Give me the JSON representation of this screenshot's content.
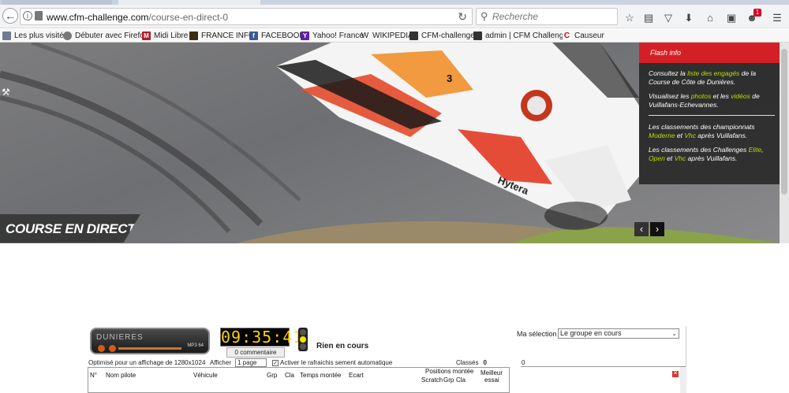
{
  "browser": {
    "url_host": "www.cfm-challenge.com",
    "url_path": "/course-en-direct-0",
    "search_placeholder": "Recherche",
    "notification_count": "1",
    "bookmarks": [
      {
        "label": "Les plus visités",
        "icon": "bookmarks-folder-icon"
      },
      {
        "label": "Débuter avec Firefox",
        "icon": "firefox-icon"
      },
      {
        "label": "Midi Libre",
        "icon": "midilibre-m-icon"
      },
      {
        "label": "FRANCE INFO",
        "icon": "franceinfo-icon"
      },
      {
        "label": "FACEBOOK",
        "icon": "facebook-icon"
      },
      {
        "label": "Yahoo! France",
        "icon": "yahoo-y-icon"
      },
      {
        "label": "WIKIPEDIA",
        "icon": "wikipedia-w-icon"
      },
      {
        "label": "CFM-challenge",
        "icon": "cfm-icon"
      },
      {
        "label": "admin | CFM Challenge",
        "icon": "cfm-admin-icon"
      },
      {
        "label": "Causeur",
        "icon": "causeur-icon"
      }
    ]
  },
  "hero": {
    "title": "COURSE EN DIRECT",
    "car_number": "3",
    "sponsor": "Hytera",
    "flash": {
      "heading": "Flash info",
      "p1_a": "Consultez la ",
      "p1_link": "liste des engagés",
      "p1_b": " de la Course de Côte de Dunières.",
      "p2_a": "Visualisez les ",
      "p2_link1": "photos",
      "p2_b": " et les ",
      "p2_link2": "vidéos",
      "p2_c": " de Vuillafans-Echevannes.",
      "p3_a": "Les classements des championnats ",
      "p3_link1": "Moderne",
      "p3_b": " et ",
      "p3_link2": "Vhc",
      "p3_c": " après Vuillafans.",
      "p4_a": "Les classements des Challenges ",
      "p4_link1": "Elite",
      "p4_b": ", ",
      "p4_link2": "Open",
      "p4_c": " et ",
      "p4_link3": "Vhc",
      "p4_d": " après Vuillafans."
    }
  },
  "live": {
    "event_name": "DUNIERES",
    "player_label": "MP3 64",
    "clock": "09:35:41",
    "comment_button": "0 commentaire",
    "status": "Rien en cours",
    "optimized": "Optimisé pour un affichage de 1280x1024",
    "afficher_label": "Afficher",
    "page_option": "1 page",
    "refresh_label": "Activer le rafraichis sement automatique",
    "classes_label": "Classés",
    "classes_count": "0",
    "selection_label": "Ma sélection",
    "selection_value": "Le groupe en cours",
    "right_count": "0",
    "columns": {
      "num": "N°",
      "pilot": "Nom pilote",
      "vehicle": "Véhicule",
      "grp": "Grp",
      "cla": "Cla",
      "time": "Temps montée",
      "gap": "Ecart",
      "positions": "Positions montée",
      "scratch": "Scratch",
      "pgrp": "Grp",
      "pcla": "Cla",
      "best1": "Meilleur",
      "best2": "essai"
    }
  }
}
